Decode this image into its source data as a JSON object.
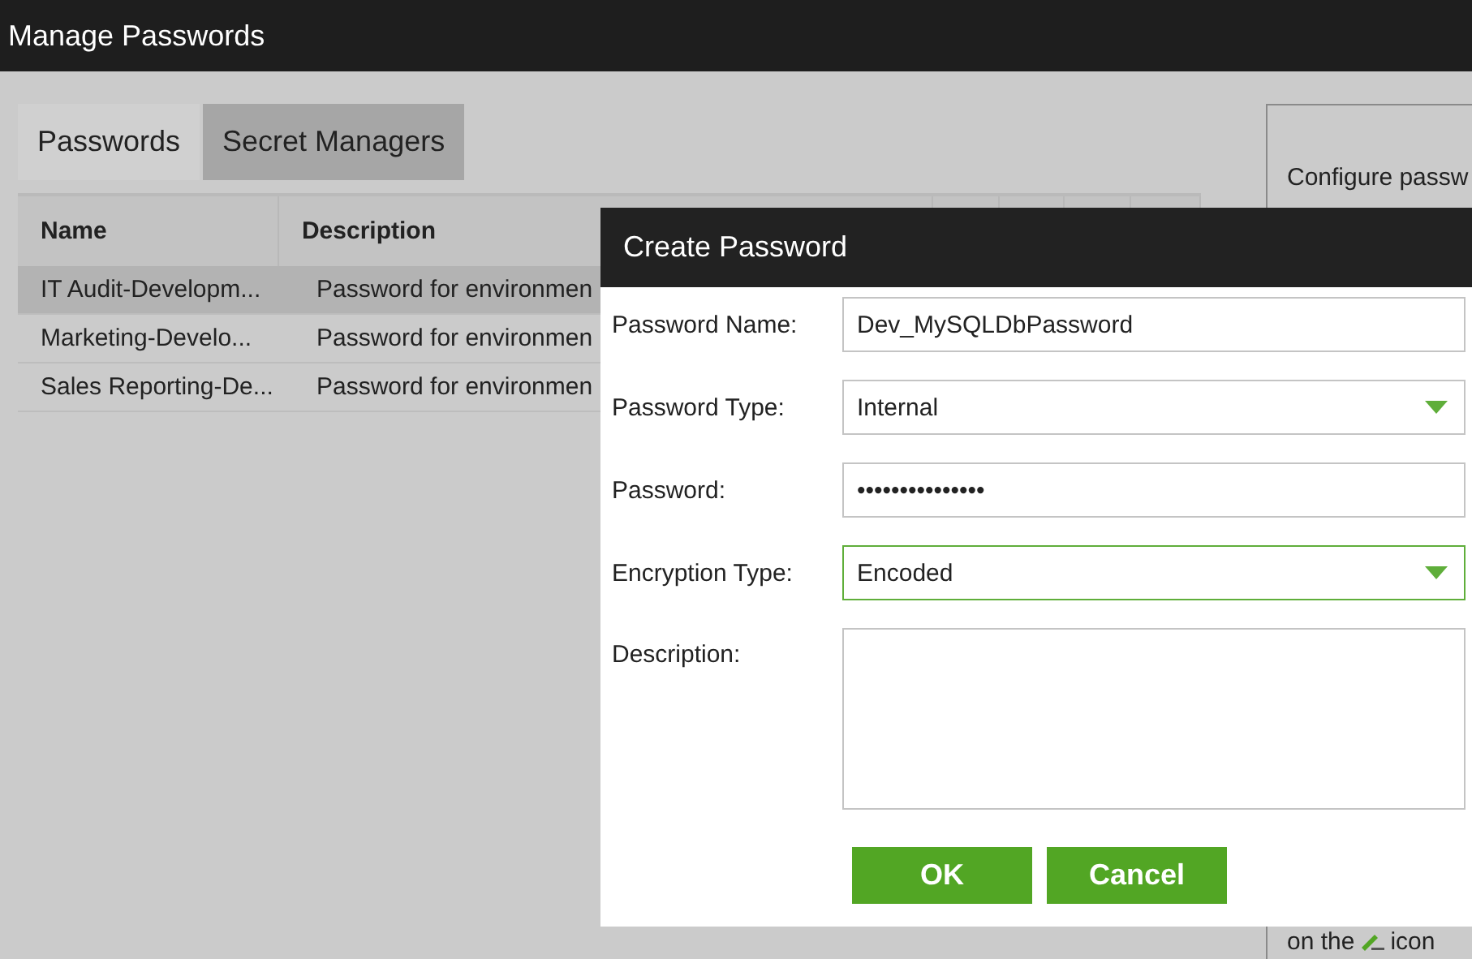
{
  "window": {
    "title": "Manage Passwords"
  },
  "tabs": [
    {
      "label": "Passwords",
      "selected": true
    },
    {
      "label": "Secret Managers",
      "selected": false
    }
  ],
  "table": {
    "columns": [
      "Name",
      "Description"
    ],
    "rows": [
      {
        "cells": [
          "IT Audit-Developm...",
          "Password for environmen"
        ],
        "selected": true
      },
      {
        "cells": [
          "Marketing-Develo...",
          "Password for environmen"
        ],
        "selected": false
      },
      {
        "cells": [
          "Sales Reporting-De...",
          "Password for environmen"
        ],
        "selected": false
      }
    ]
  },
  "side_panel": {
    "intro": "Configure passw",
    "footer_before": "on the",
    "footer_after": "icon"
  },
  "dialog": {
    "title": "Create Password",
    "fields": [
      {
        "label": "Password Name:",
        "kind": "text",
        "value": "Dev_MySQLDbPassword",
        "focused": false
      },
      {
        "label": "Password Type:",
        "kind": "select",
        "value": "Internal",
        "focused": false
      },
      {
        "label": "Password:",
        "kind": "text",
        "value": "•••••••••••••••",
        "focused": false
      },
      {
        "label": "Encryption Type:",
        "kind": "select",
        "value": "Encoded",
        "focused": true
      },
      {
        "label": "Description:",
        "kind": "textarea",
        "focused": false
      }
    ],
    "buttons": [
      "OK",
      "Cancel"
    ]
  }
}
